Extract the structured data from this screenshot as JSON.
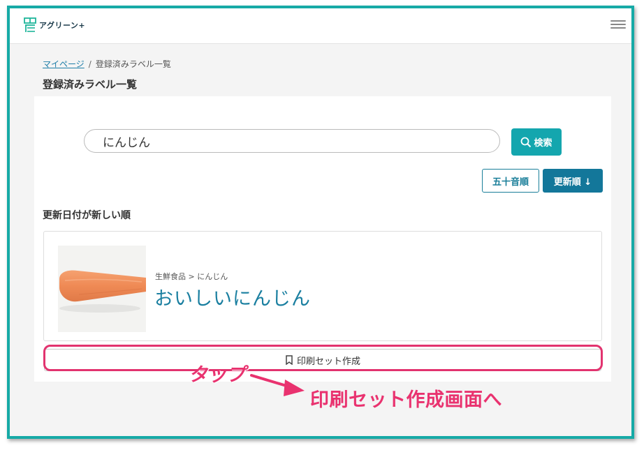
{
  "header": {
    "logo_text": "アグリーン+",
    "logo_icon": "farm-kanji-logo-icon",
    "menu_icon": "hamburger-menu-icon"
  },
  "breadcrumb": {
    "home_link": "マイページ",
    "separator": "/",
    "current": "登録済みラベル一覧"
  },
  "page_title": "登録済みラベル一覧",
  "search": {
    "value": "にんじん",
    "button_label": "検索",
    "button_icon": "search-icon"
  },
  "sort": {
    "aiueo_label": "五十音順",
    "updated_label": "更新順 ↓"
  },
  "section_heading": "更新日付が新しい順",
  "item": {
    "category": "生鮮食品 > にんじん",
    "name": "おいしいにんじん",
    "image_icon": "carrot-image"
  },
  "print_button": {
    "label": "印刷セット作成",
    "icon": "bookmark-icon"
  },
  "annotation": {
    "tap": "タップ",
    "destination": "印刷セット作成画面へ",
    "color": "#e9326f"
  },
  "colors": {
    "accent": "#14a6ae",
    "primary": "#13779a",
    "frame": "#16aaa6",
    "link": "#1f7ea8"
  }
}
